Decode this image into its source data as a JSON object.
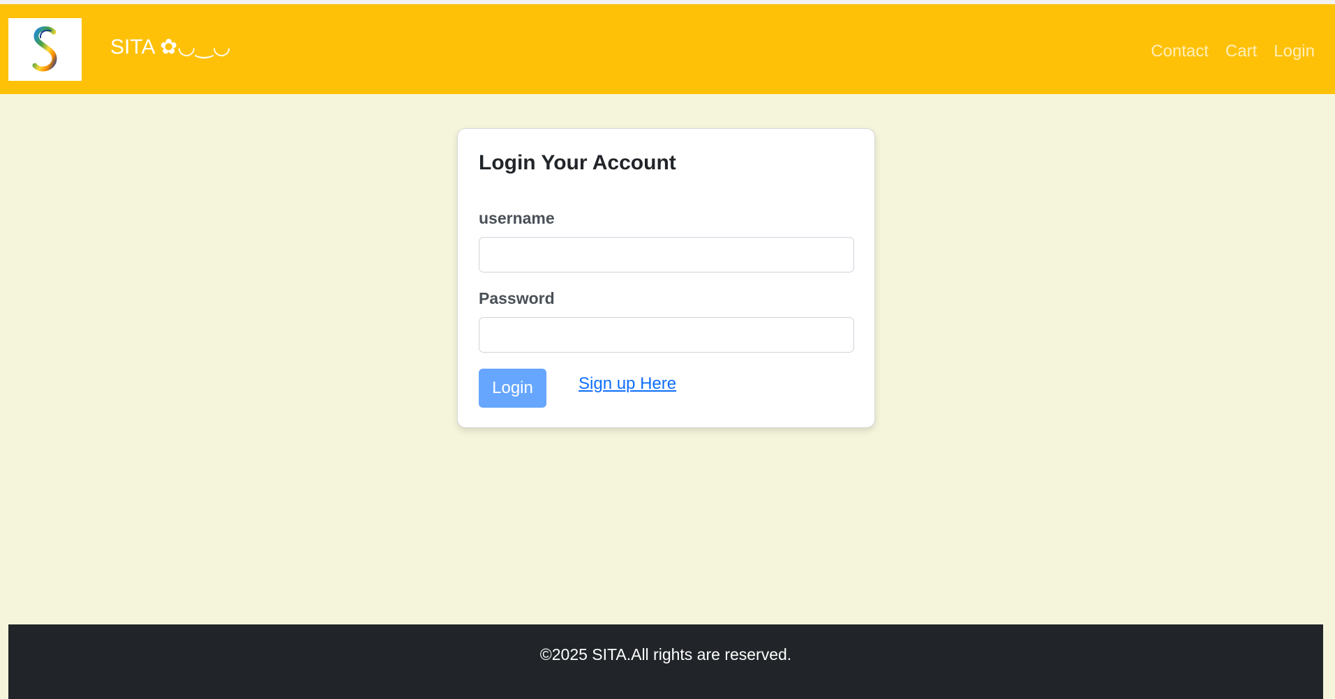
{
  "header": {
    "brand": "SITA ✿◡‿◡",
    "logo_letter": "S",
    "nav": [
      "Contact",
      "Cart",
      "Login"
    ]
  },
  "login_form": {
    "title": "Login Your Account",
    "username_label": "username",
    "username_value": "",
    "password_label": "Password",
    "password_value": "",
    "submit_label": "Login",
    "signup_link": "Sign up Here"
  },
  "footer": {
    "text": "©2025 SITA.All rights are reserved."
  },
  "colors": {
    "navbar": "#ffc107",
    "page_background": "#f5f5dc",
    "login_button": "#66a6ff",
    "link": "#0d6efd",
    "footer": "#212529"
  }
}
